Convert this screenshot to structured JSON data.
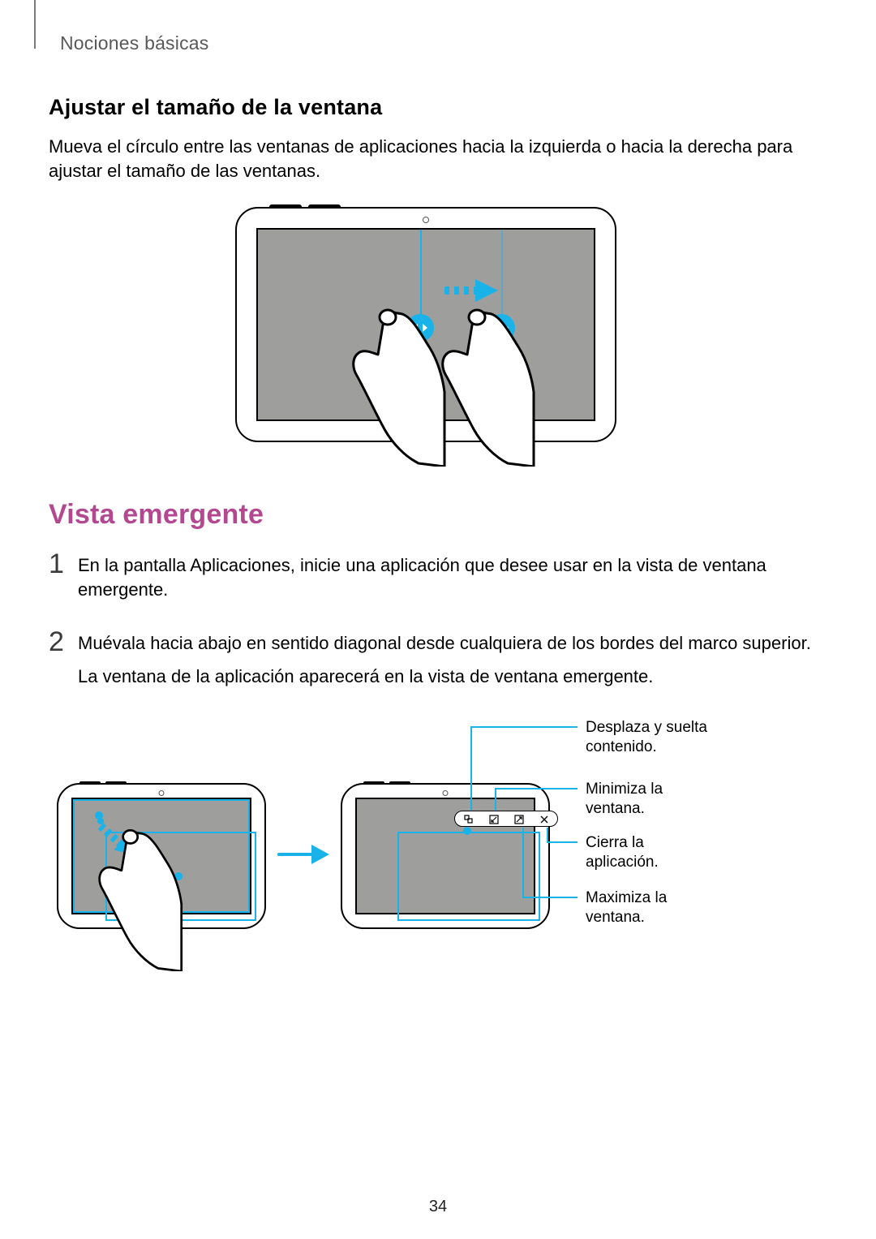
{
  "breadcrumb": "Nociones básicas",
  "section1": {
    "heading": "Ajustar el tamaño de la ventana",
    "body": "Mueva el círculo entre las ventanas de aplicaciones hacia la izquierda o hacia la derecha para ajustar el tamaño de las ventanas."
  },
  "section2": {
    "heading": "Vista emergente"
  },
  "steps": [
    {
      "num": "1",
      "lines": [
        "En la pantalla Aplicaciones, inicie una aplicación que desee usar en la vista de ventana emergente."
      ]
    },
    {
      "num": "2",
      "lines": [
        "Muévala hacia abajo en sentido diagonal desde cualquiera de los bordes del marco superior.",
        "La ventana de la aplicación aparecerá en la vista de ventana emergente."
      ]
    }
  ],
  "callouts": {
    "drag": "Desplaza y suelta contenido.",
    "minimize": "Minimiza la ventana.",
    "close": "Cierra la aplicación.",
    "maximize": "Maximiza la ventana."
  },
  "page_number": "34"
}
